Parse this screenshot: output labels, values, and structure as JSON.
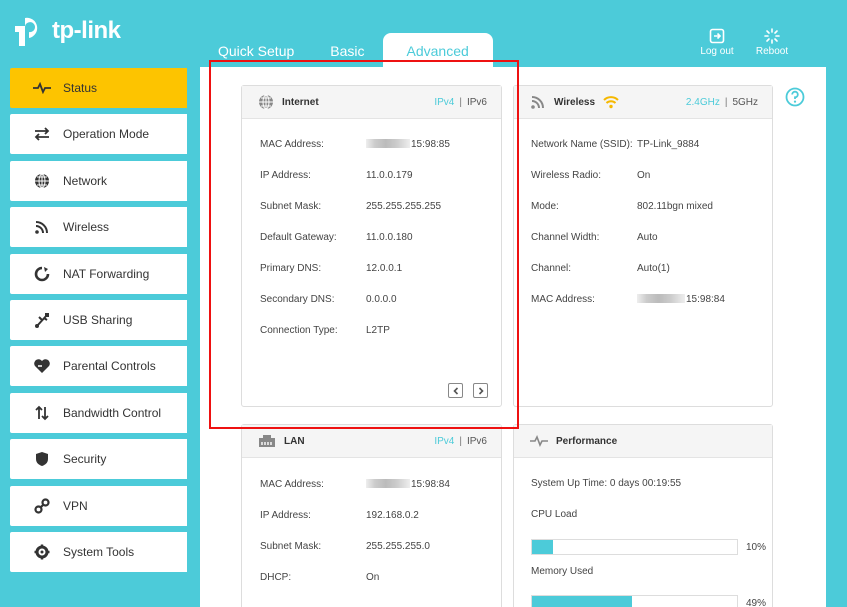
{
  "header": {
    "brand": "tp-link",
    "tabs": [
      {
        "label": "Quick Setup"
      },
      {
        "label": "Basic"
      },
      {
        "label": "Advanced"
      }
    ],
    "logout_label": "Log out",
    "reboot_label": "Reboot"
  },
  "sidebar": {
    "items": [
      {
        "label": "Status",
        "icon": "pulse-icon"
      },
      {
        "label": "Operation Mode",
        "icon": "swap-arrows-icon"
      },
      {
        "label": "Network",
        "icon": "globe-icon"
      },
      {
        "label": "Wireless",
        "icon": "wifi-icon"
      },
      {
        "label": "NAT Forwarding",
        "icon": "refresh-icon"
      },
      {
        "label": "USB Sharing",
        "icon": "usb-icon"
      },
      {
        "label": "Parental Controls",
        "icon": "heart-icon"
      },
      {
        "label": "Bandwidth Control",
        "icon": "up-down-arrows-icon"
      },
      {
        "label": "Security",
        "icon": "shield-icon"
      },
      {
        "label": "VPN",
        "icon": "link-icon"
      },
      {
        "label": "System Tools",
        "icon": "gear-icon"
      }
    ]
  },
  "internet": {
    "title": "Internet",
    "ipv4": "IPv4",
    "ipv6": "IPv6",
    "rows": [
      {
        "label": "MAC Address:",
        "value": "15:98:85"
      },
      {
        "label": "IP Address:",
        "value": "11.0.0.179"
      },
      {
        "label": "Subnet Mask:",
        "value": "255.255.255.255"
      },
      {
        "label": "Default Gateway:",
        "value": "11.0.0.180"
      },
      {
        "label": "Primary DNS:",
        "value": "12.0.0.1"
      },
      {
        "label": "Secondary DNS:",
        "value": "0.0.0.0"
      },
      {
        "label": "Connection Type:",
        "value": "L2TP"
      }
    ]
  },
  "wireless": {
    "title": "Wireless",
    "band_24": "2.4GHz",
    "band_5": "5GHz",
    "rows": [
      {
        "label": "Network Name (SSID):",
        "value": "TP-Link_9884"
      },
      {
        "label": "Wireless Radio:",
        "value": "On"
      },
      {
        "label": "Mode:",
        "value": "802.11bgn mixed"
      },
      {
        "label": "Channel Width:",
        "value": "Auto"
      },
      {
        "label": "Channel:",
        "value": "Auto(1)"
      },
      {
        "label": "MAC Address:",
        "value": "15:98:84"
      }
    ]
  },
  "lan": {
    "title": "LAN",
    "ipv4": "IPv4",
    "ipv6": "IPv6",
    "rows": [
      {
        "label": "MAC Address:",
        "value": "15:98:84"
      },
      {
        "label": "IP Address:",
        "value": "192.168.0.2"
      },
      {
        "label": "Subnet Mask:",
        "value": "255.255.255.0"
      },
      {
        "label": "DHCP:",
        "value": "On"
      }
    ]
  },
  "performance": {
    "title": "Performance",
    "uptime": "System Up Time: 0 days 00:19:55",
    "cpu_label": "CPU Load",
    "cpu_percent": 10,
    "cpu_text": "10%",
    "mem_label": "Memory Used",
    "mem_percent": 49,
    "mem_text": "49%"
  },
  "colors": {
    "accent": "#4ccbd9",
    "active_menu": "#fdc400",
    "highlight": "#e11111"
  }
}
